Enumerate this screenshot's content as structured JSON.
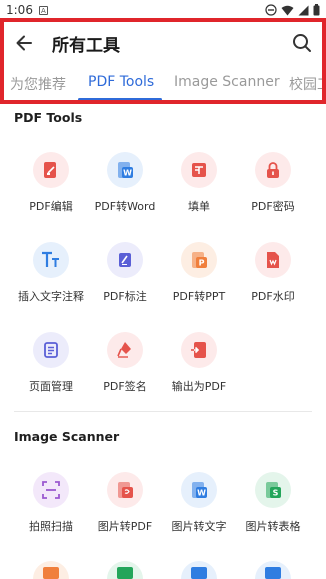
{
  "status_bar": {
    "time": "1:06",
    "a_badge": "A"
  },
  "header": {
    "title": "所有工具",
    "back_icon": "arrow-left-icon",
    "search_icon": "search-icon"
  },
  "tabs": [
    {
      "label": "为您推荐",
      "active": false
    },
    {
      "label": "PDF Tools",
      "active": true
    },
    {
      "label": "Image Scanner",
      "active": false
    },
    {
      "label": "校园工",
      "active": false
    }
  ],
  "sections": {
    "pdf_tools": {
      "title": "PDF Tools",
      "items": [
        {
          "label": "PDF编辑",
          "icon": "pdf-edit-icon",
          "color": "#e5534b",
          "bg": "#fdeaea"
        },
        {
          "label": "PDF转Word",
          "icon": "pdf-to-word-icon",
          "color": "#2f7de1",
          "bg": "#e6f0fc"
        },
        {
          "label": "填单",
          "icon": "fill-form-icon",
          "color": "#e5534b",
          "bg": "#fdeaea"
        },
        {
          "label": "PDF密码",
          "icon": "lock-icon",
          "color": "#e5534b",
          "bg": "#fdeaea"
        },
        {
          "label": "插入文字注释",
          "icon": "text-annotation-icon",
          "color": "#2f7de1",
          "bg": "#e6f0fc"
        },
        {
          "label": "PDF标注",
          "icon": "highlighter-icon",
          "color": "#5a5fd6",
          "bg": "#ececfb"
        },
        {
          "label": "PDF转PPT",
          "icon": "pdf-to-ppt-icon",
          "color": "#f07f3c",
          "bg": "#fdeee3"
        },
        {
          "label": "PDF水印",
          "icon": "watermark-icon",
          "color": "#e5534b",
          "bg": "#fdeaea"
        },
        {
          "label": "页面管理",
          "icon": "page-manage-icon",
          "color": "#5a5fd6",
          "bg": "#ececfb"
        },
        {
          "label": "PDF签名",
          "icon": "signature-pen-icon",
          "color": "#e5534b",
          "bg": "#fdeaea"
        },
        {
          "label": "输出为PDF",
          "icon": "export-pdf-icon",
          "color": "#e5534b",
          "bg": "#fdeaea"
        }
      ]
    },
    "image_scanner": {
      "title": "Image Scanner",
      "items": [
        {
          "label": "拍照扫描",
          "icon": "scan-icon",
          "color": "#9b59d0",
          "bg": "#f3e8fa"
        },
        {
          "label": "图片转PDF",
          "icon": "image-to-pdf-icon",
          "color": "#e5534b",
          "bg": "#fdeaea"
        },
        {
          "label": "图片转文字",
          "icon": "image-to-text-icon",
          "color": "#2f7de1",
          "bg": "#e6f0fc"
        },
        {
          "label": "图片转表格",
          "icon": "image-to-excel-icon",
          "color": "#23a55a",
          "bg": "#e4f5eb"
        }
      ]
    }
  },
  "colors": {
    "accent": "#2f6bd9",
    "highlight_border": "#e0252b"
  }
}
